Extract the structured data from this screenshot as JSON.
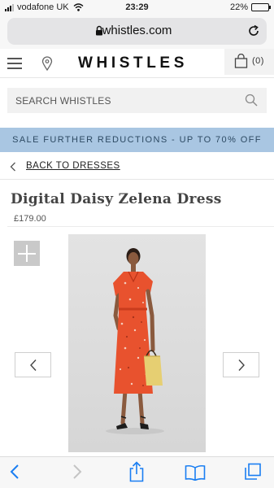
{
  "status_bar": {
    "carrier": "vodafone UK",
    "time": "23:29",
    "battery": "22%",
    "battery_level": 0.22
  },
  "browser": {
    "url": "whistles.com",
    "lock_icon": "lock-icon",
    "reload_icon": "reload-icon"
  },
  "header": {
    "logo": "WHISTLES",
    "menu_icon": "hamburger-menu-icon",
    "location_icon": "map-pin-icon",
    "bag_icon": "shopping-bag-icon",
    "bag_count": "(0)"
  },
  "search": {
    "placeholder": "SEARCH WHISTLES",
    "icon": "search-icon"
  },
  "promo": {
    "text": "SALE FURTHER REDUCTIONS - UP TO 70% OFF",
    "background": "#a9c6e2"
  },
  "navigation": {
    "back_label": "BACK TO DRESSES"
  },
  "product": {
    "title": "Digital Daisy Zelena Dress",
    "price": "£179.00",
    "dress_color": "#e8522e"
  },
  "gallery": {
    "zoom_icon": "plus-zoom-icon",
    "prev_icon": "chevron-left-icon",
    "next_icon": "chevron-right-icon"
  },
  "toolbar": {
    "items": [
      "back-arrow-icon",
      "forward-arrow-icon",
      "share-icon",
      "bookmarks-icon",
      "tabs-icon"
    ],
    "accent": "#1a7ef2"
  }
}
